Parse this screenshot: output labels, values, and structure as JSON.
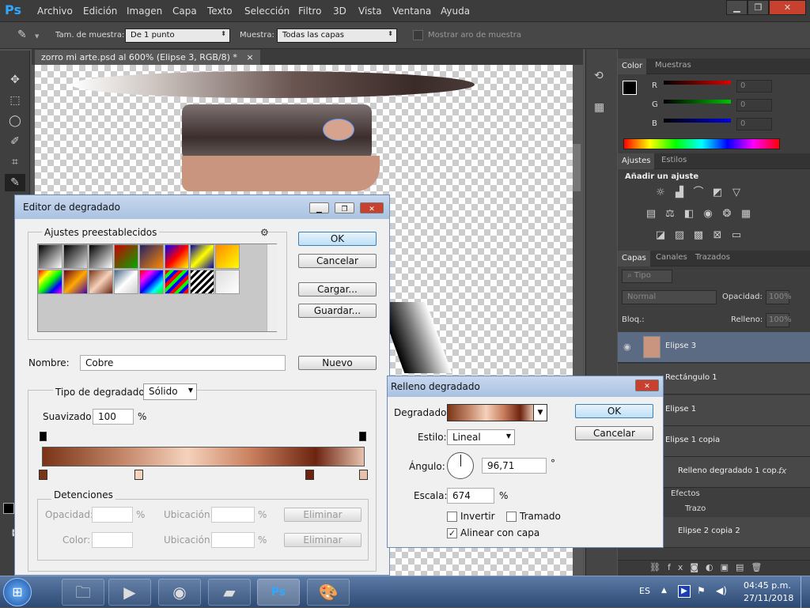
{
  "app": {
    "logo": "Ps",
    "menus": [
      "Archivo",
      "Edición",
      "Imagen",
      "Capa",
      "Texto",
      "Selección",
      "Filtro",
      "3D",
      "Vista",
      "Ventana",
      "Ayuda"
    ]
  },
  "options": {
    "sample_size_label": "Tam. de muestra:",
    "sample_size_value": "De 1 punto",
    "sample_label": "Muestra:",
    "sample_value": "Todas las capas",
    "ring_label": "Mostrar aro de muestra"
  },
  "document": {
    "tab_title": "zorro mi arte.psd al 600% (Elipse 3, RGB/8) *",
    "close": "×"
  },
  "color_panel": {
    "tabs": [
      "Color",
      "Muestras"
    ],
    "channels": [
      {
        "label": "R",
        "value": "0",
        "color": "#e00000"
      },
      {
        "label": "G",
        "value": "0",
        "color": "#00c000"
      },
      {
        "label": "B",
        "value": "0",
        "color": "#0000e0"
      }
    ]
  },
  "adjustments_panel": {
    "tabs": [
      "Ajustes",
      "Estilos"
    ],
    "heading": "Añadir un ajuste"
  },
  "layers_panel": {
    "tabs": [
      "Capas",
      "Canales",
      "Trazados"
    ],
    "filter": "Tipo",
    "blend_mode": "Normal",
    "opacity_label": "Opacidad:",
    "opacity_value": "100%",
    "lock_label": "Bloq.:",
    "fill_label": "Relleno:",
    "fill_value": "100%",
    "layers": [
      {
        "name": "Elipse 3",
        "selected": true
      },
      {
        "name": "Rectángulo 1",
        "selected": false
      },
      {
        "name": "Elipse 1",
        "selected": false
      },
      {
        "name": "Elipse 1 copia",
        "selected": false
      },
      {
        "name": "Relleno degradado 1 cop...",
        "selected": false
      }
    ],
    "effects_label": "Efectos",
    "stroke_label": "Trazo",
    "last_layer": "Elipse 2 copia 2",
    "fx": "fx"
  },
  "gradient_editor": {
    "title": "Editor de degradado",
    "presets_label": "Ajustes preestablecidos",
    "ok": "OK",
    "cancel": "Cancelar",
    "load": "Cargar...",
    "save": "Guardar...",
    "name_label": "Nombre:",
    "name_value": "Cobre",
    "new": "Nuevo",
    "type_label": "Tipo de degradado:",
    "type_value": "Sólido",
    "smooth_label": "Suavizado:",
    "smooth_value": "100",
    "smooth_unit": "%",
    "stops_label": "Detenciones",
    "opacity_label": "Opacidad:",
    "location_label": "Ubicación:",
    "color_label": "Color:",
    "percent": "%",
    "delete": "Eliminar"
  },
  "gradient_fill": {
    "title": "Relleno degradado",
    "gradient_label": "Degradado:",
    "style_label": "Estilo:",
    "style_value": "Lineal",
    "angle_label": "Ángulo:",
    "angle_value": "96,71",
    "degree": "°",
    "scale_label": "Escala:",
    "scale_value": "674",
    "scale_unit": "%",
    "invert_label": "Invertir",
    "dither_label": "Tramado",
    "align_label": "Alinear con capa",
    "ok": "OK",
    "cancel": "Cancelar"
  },
  "taskbar": {
    "lang": "ES",
    "time": "04:45 p.m.",
    "date": "27/11/2018"
  },
  "colors": {
    "copper_gradient": "linear-gradient(90deg,#7a3416 0%,#c4876a 25%,#f5d2bc 45%,#c97f5e 65%,#6c2410 85%,#e6c2ad 100%)"
  }
}
